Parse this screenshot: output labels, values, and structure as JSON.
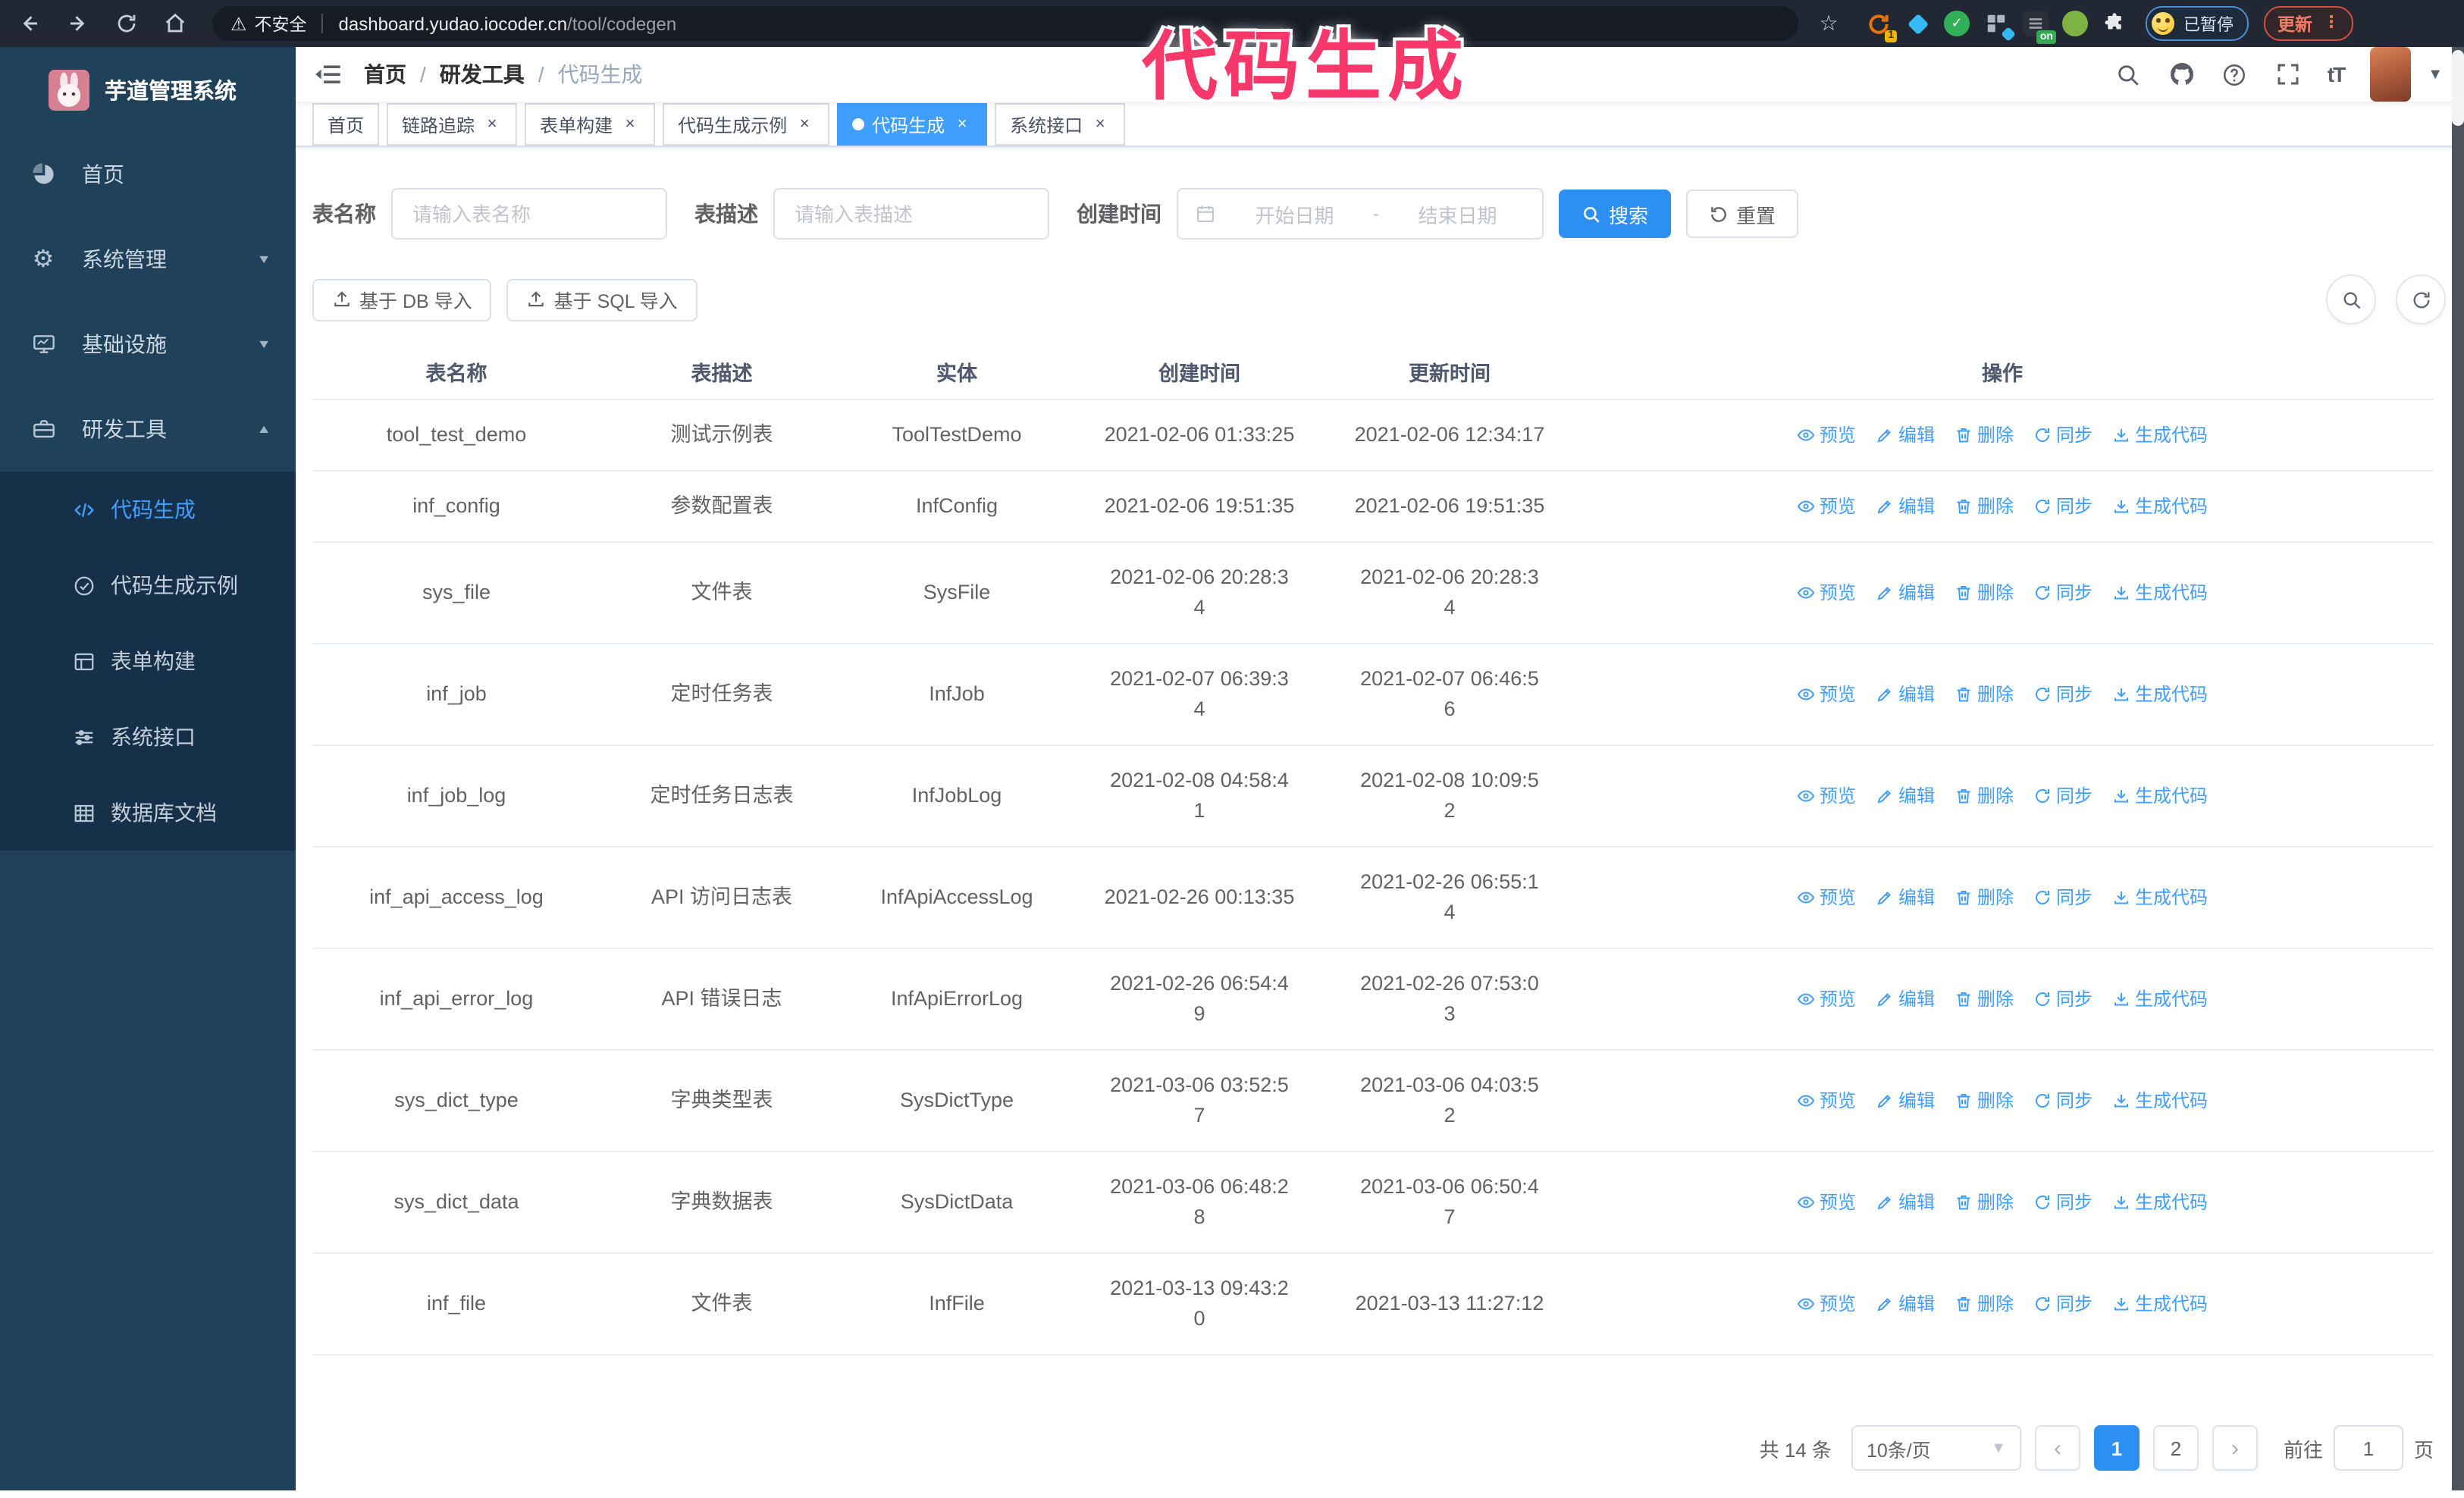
{
  "colors": {
    "primary": "#2e8ff2",
    "active_menu": "#409eff",
    "sidebar_bg": "#20415a",
    "sidebar_submenu_bg": "#16304a",
    "annotation": "#f8376b",
    "tag_active_bg": "#409eff"
  },
  "annotation": {
    "text": "代码生成"
  },
  "browser": {
    "security_label": "不安全",
    "url_host": "dashboard.yudao.iocoder.cn",
    "url_path": "/tool/codegen",
    "extension_badge_count": "1",
    "extension_badge_on": "on",
    "profile_chip_label": "已暂停",
    "update_button_label": "更新"
  },
  "sidebar": {
    "app_title": "芋道管理系统",
    "items": [
      {
        "label": "首页"
      },
      {
        "label": "系统管理"
      },
      {
        "label": "基础设施"
      },
      {
        "label": "研发工具"
      }
    ],
    "submenu": [
      {
        "label": "代码生成",
        "active": true
      },
      {
        "label": "代码生成示例"
      },
      {
        "label": "表单构建"
      },
      {
        "label": "系统接口"
      },
      {
        "label": "数据库文档"
      }
    ]
  },
  "navbar": {
    "breadcrumb": [
      {
        "label": "首页"
      },
      {
        "label": "研发工具"
      },
      {
        "label": "代码生成"
      }
    ],
    "separator": "/"
  },
  "tags": [
    {
      "label": "首页",
      "closable": false
    },
    {
      "label": "链路追踪",
      "closable": true
    },
    {
      "label": "表单构建",
      "closable": true
    },
    {
      "label": "代码生成示例",
      "closable": true
    },
    {
      "label": "代码生成",
      "closable": true,
      "active": true
    },
    {
      "label": "系统接口",
      "closable": true
    }
  ],
  "filters": {
    "name_label": "表名称",
    "name_placeholder": "请输入表名称",
    "desc_label": "表描述",
    "desc_placeholder": "请输入表描述",
    "time_label": "创建时间",
    "start_placeholder": "开始日期",
    "range_separator": "-",
    "end_placeholder": "结束日期",
    "search_label": "搜索",
    "reset_label": "重置"
  },
  "toolbar": {
    "import_db_label": "基于 DB 导入",
    "import_sql_label": "基于 SQL 导入"
  },
  "table": {
    "columns": [
      "表名称",
      "表描述",
      "实体",
      "创建时间",
      "更新时间",
      "操作"
    ],
    "action_labels": [
      "预览",
      "编辑",
      "删除",
      "同步",
      "生成代码"
    ],
    "rows": [
      {
        "name": "tool_test_demo",
        "desc": "测试示例表",
        "entity": "ToolTestDemo",
        "created": "2021-02-06 01:33:25",
        "updated": "2021-02-06 12:34:17"
      },
      {
        "name": "inf_config",
        "desc": "参数配置表",
        "entity": "InfConfig",
        "created": "2021-02-06 19:51:35",
        "updated": "2021-02-06 19:51:35"
      },
      {
        "name": "sys_file",
        "desc": "文件表",
        "entity": "SysFile",
        "created": "2021-02-06 20:28:3\n4",
        "updated": "2021-02-06 20:28:3\n4"
      },
      {
        "name": "inf_job",
        "desc": "定时任务表",
        "entity": "InfJob",
        "created": "2021-02-07 06:39:3\n4",
        "updated": "2021-02-07 06:46:5\n6"
      },
      {
        "name": "inf_job_log",
        "desc": "定时任务日志表",
        "entity": "InfJobLog",
        "created": "2021-02-08 04:58:4\n1",
        "updated": "2021-02-08 10:09:5\n2"
      },
      {
        "name": "inf_api_access_log",
        "desc": "API 访问日志表",
        "entity": "InfApiAccessLog",
        "created": "2021-02-26 00:13:35",
        "updated": "2021-02-26 06:55:1\n4"
      },
      {
        "name": "inf_api_error_log",
        "desc": "API 错误日志",
        "entity": "InfApiErrorLog",
        "created": "2021-02-26 06:54:4\n9",
        "updated": "2021-02-26 07:53:0\n3"
      },
      {
        "name": "sys_dict_type",
        "desc": "字典类型表",
        "entity": "SysDictType",
        "created": "2021-03-06 03:52:5\n7",
        "updated": "2021-03-06 04:03:5\n2"
      },
      {
        "name": "sys_dict_data",
        "desc": "字典数据表",
        "entity": "SysDictData",
        "created": "2021-03-06 06:48:2\n8",
        "updated": "2021-03-06 06:50:4\n7"
      },
      {
        "name": "inf_file",
        "desc": "文件表",
        "entity": "InfFile",
        "created": "2021-03-13 09:43:2\n0",
        "updated": "2021-03-13 11:27:12"
      }
    ]
  },
  "pagination": {
    "total_label": "共 14 条",
    "page_size_label": "10条/页",
    "pages": [
      {
        "label": "1",
        "active": true
      },
      {
        "label": "2"
      }
    ],
    "goto_label": "前往",
    "goto_value": "1",
    "page_unit_label": "页"
  }
}
